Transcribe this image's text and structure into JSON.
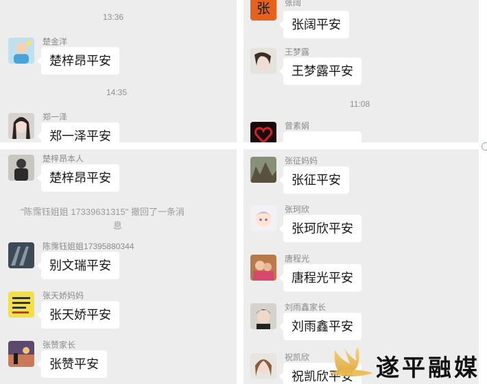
{
  "top_left": {
    "timestamps": [
      "13:36",
      "14:35"
    ],
    "messages": [
      {
        "sender": "楚金洋",
        "text": "楚梓昂平安"
      },
      {
        "sender": "郑一泽",
        "text": "郑一泽平安"
      }
    ]
  },
  "top_right": {
    "timestamp": "11:08",
    "messages": [
      {
        "sender": "张阔",
        "text": "张阔平安"
      },
      {
        "sender": "王梦露",
        "text": "王梦露平安"
      },
      {
        "sender": "曾素娟",
        "text": ""
      }
    ]
  },
  "bottom_left": {
    "recall_notice_line1": "\"陈霈钰姐姐 17339631315\" 撤回了一条消",
    "recall_notice_line2": "息",
    "messages": [
      {
        "sender": "楚梓昂本人",
        "text": "楚梓昂平安"
      },
      {
        "sender": "陈霈钰姐姐17395880344",
        "text": "别文瑞平安"
      },
      {
        "sender": "张天娇妈妈",
        "text": "张天娇平安"
      },
      {
        "sender": "张赞家长",
        "text": "张赞平安"
      }
    ]
  },
  "bottom_right": {
    "messages": [
      {
        "sender": "张征妈妈",
        "text": "张征平安"
      },
      {
        "sender": "张珂欣",
        "text": "张珂欣平安"
      },
      {
        "sender": "唐程光",
        "text": "唐程光平安"
      },
      {
        "sender": "刘雨鑫家长",
        "text": "刘雨鑫平安"
      },
      {
        "sender": "祝凯欣",
        "text": "祝凯欣平安"
      }
    ]
  },
  "watermark": {
    "text": "遂平融媒"
  },
  "colors": {
    "panel_bg": "#ededed",
    "bubble_bg": "#ffffff",
    "sender": "#8a8a8a",
    "watermark_gold": "#e8b84a"
  },
  "icons": [
    "avatar",
    "watermark-logo"
  ]
}
